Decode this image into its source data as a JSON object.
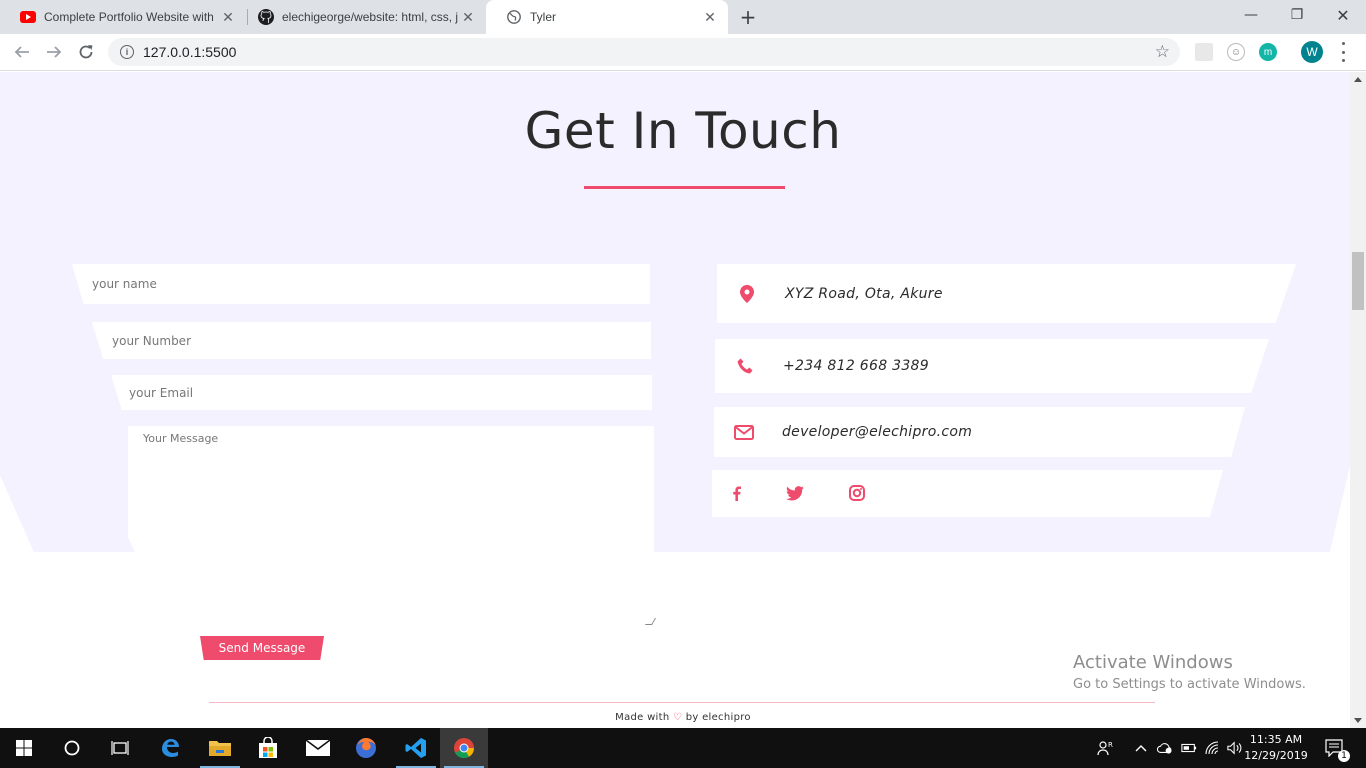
{
  "browser": {
    "tabs": [
      {
        "title": "Complete Portfolio Website with",
        "icon": "youtube-icon"
      },
      {
        "title": "elechigeorge/website: html, css, j",
        "icon": "github-icon"
      },
      {
        "title": "Tyler",
        "icon": "globe-icon"
      }
    ],
    "url": "127.0.0.1:5500",
    "profile_initial": "W",
    "extension_initial": "m"
  },
  "page": {
    "heading": "Get In Touch",
    "accent_color": "#ef4b6c",
    "form": {
      "name_placeholder": "your name",
      "number_placeholder": "your Number",
      "email_placeholder": "your Email",
      "message_placeholder": "Your Message",
      "submit_label": "Send Message"
    },
    "contact": {
      "address": "XYZ Road, Ota, Akure",
      "phone": "+234 812 668 3389",
      "email": "developer@elechipro.com",
      "socials": [
        "facebook-icon",
        "twitter-icon",
        "instagram-icon"
      ]
    },
    "footer": {
      "made_with": "Made with",
      "by": "by elechipro"
    }
  },
  "watermark": {
    "line1": "Activate Windows",
    "line2": "Go to Settings to activate Windows."
  },
  "taskbar": {
    "time": "11:35 AM",
    "date": "12/29/2019",
    "notification_count": "1"
  }
}
